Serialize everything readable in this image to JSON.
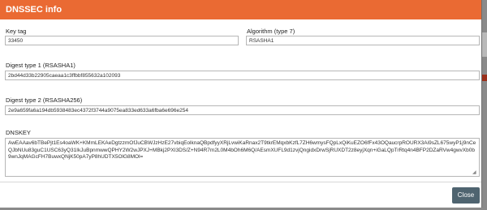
{
  "dialog": {
    "title": "DNSSEC info",
    "close_label": "Close"
  },
  "fields": {
    "key_tag": {
      "label": "Key tag",
      "value": "33450"
    },
    "algorithm": {
      "label": "Algorithm (type 7)",
      "value": "RSASHA1"
    },
    "digest1": {
      "label": "Digest type 1 (RSASHA1)",
      "value": "2bd44d33b22905caeaa1c3ffbbf855632a102093"
    },
    "digest2": {
      "label": "Digest type 2 (RSASHA256)",
      "value": "2e9a659fa6a194db5938483ec4372f3744a9075ea833ed633a6fba6e696e254"
    },
    "dnskey": {
      "label": "DNSKEY",
      "value": "AwEAAav6bTBePjt1Es4oaWK+KMmLEKAeDgtzzmOfJuCBWJzHzE27vbiqEolknaQBpdfyyXRjLvwiKaRnax2T9tkrEMqxbKzfL7ZH6wmysFQpLxQiKuEZO6fFx43OQaucrpROURX3Ai9sZL675wyP1j9nCeQJbNUu83guC1USC63yQ31IkJuBpnmwwQPHY2W2wJPXJ+MBkj2PXI3DS/Z+N94R7m2L0M4bOh6M6Q/AEsmXUFL9d1zvjQngidxDrwSjRUXDT2z8eyjXqn+iGaLQpTrRtq4n4BFP2DZaRVw4gwvXb0b9wnJqMAGcFH7BuwxQNjK50pA7yP8hUDTX5OlG8MOl="
    }
  }
}
